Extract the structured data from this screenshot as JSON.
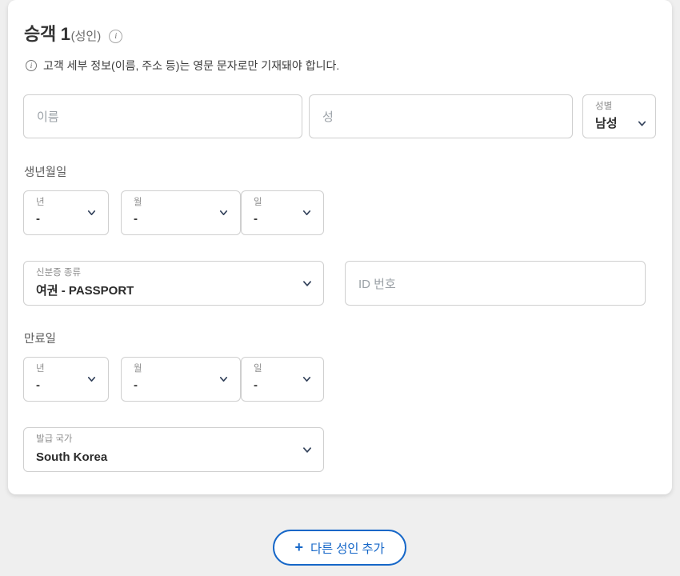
{
  "passenger_card": {
    "title": "승객 1",
    "title_sub": "(성인)",
    "info_icon_glyph": "i",
    "notice": {
      "icon_glyph": "i",
      "text": "고객 세부 정보(이름, 주소 등)는 영문 문자로만 기재돼야 합니다."
    },
    "name_row": {
      "first_name_placeholder": "이름",
      "first_name_value": "",
      "last_name_placeholder": "성",
      "last_name_value": "",
      "gender": {
        "label": "성별",
        "value": "남성"
      }
    },
    "birthdate": {
      "section_label": "생년월일",
      "year": {
        "label": "년",
        "value": "-"
      },
      "month": {
        "label": "월",
        "value": "-"
      },
      "day": {
        "label": "일",
        "value": "-"
      }
    },
    "id_row": {
      "id_type": {
        "label": "신분증 종류",
        "value": "여권 - PASSPORT"
      },
      "id_number_placeholder": "ID 번호",
      "id_number_value": ""
    },
    "expiry": {
      "section_label": "만료일",
      "year": {
        "label": "년",
        "value": "-"
      },
      "month": {
        "label": "월",
        "value": "-"
      },
      "day": {
        "label": "일",
        "value": "-"
      }
    },
    "issuing_country": {
      "label": "발급 국가",
      "value": "South Korea"
    }
  },
  "add_passenger_button": {
    "plus_glyph": "+",
    "label": "다른 성인 추가"
  },
  "colors": {
    "accent_blue": "#1667c8",
    "page_background": "#efefef",
    "card_background": "#ffffff",
    "border_grey": "#cfcfcf",
    "placeholder_grey": "#9aa0a6",
    "label_grey": "#8c8c8c"
  }
}
